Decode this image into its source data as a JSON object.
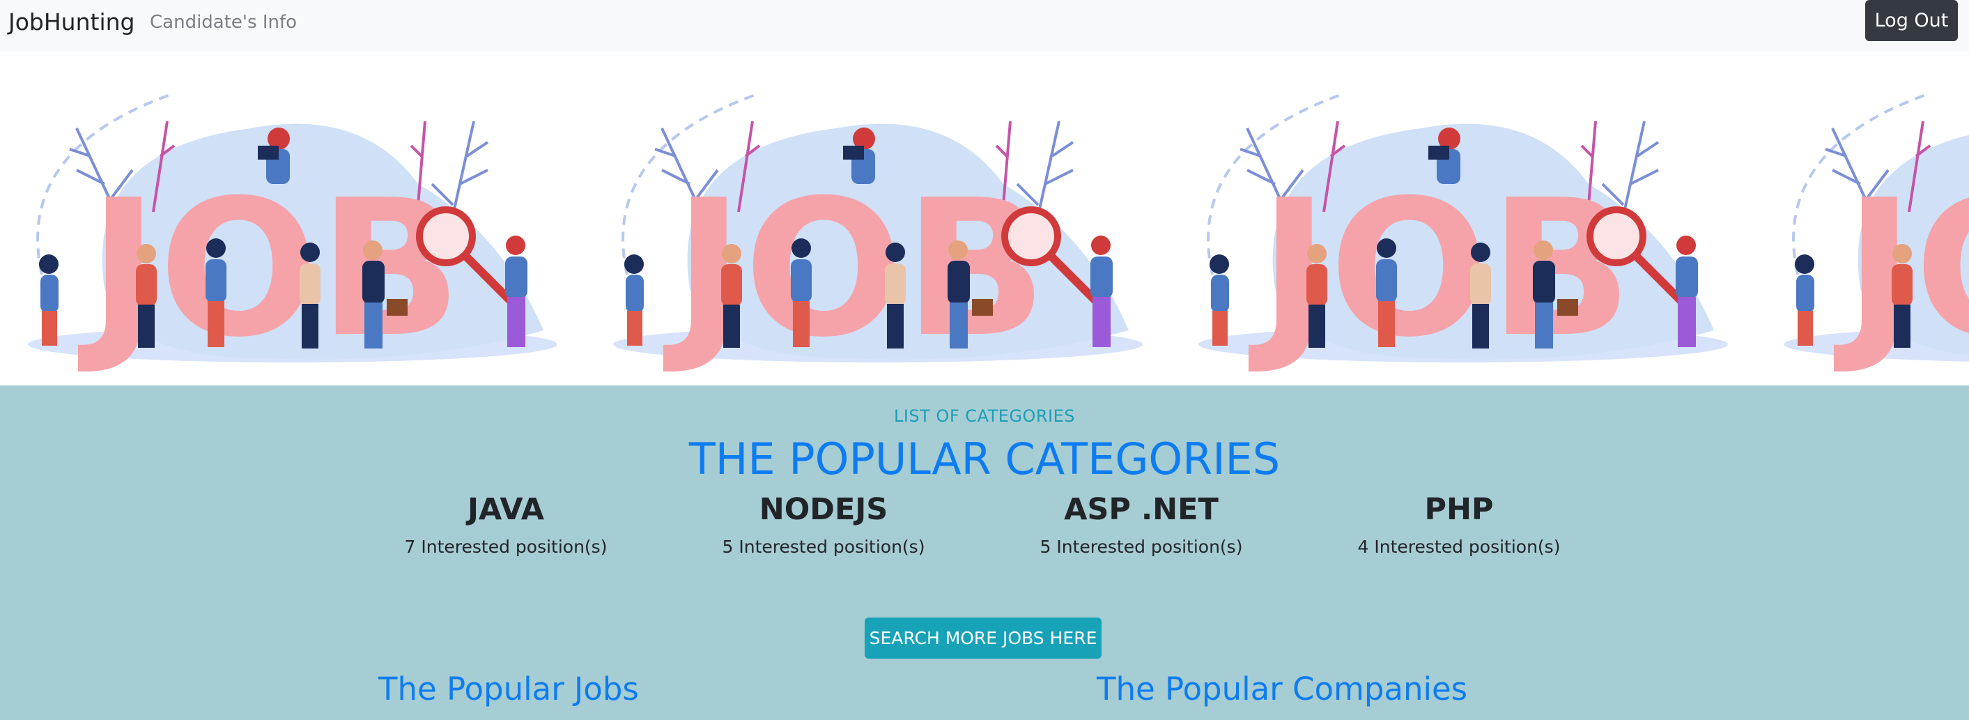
{
  "navbar": {
    "brand": "JobHunting",
    "nav_link": "Candidate's Info",
    "logout": "Log Out"
  },
  "banner": {
    "illustration_text": "JOB",
    "tile_count": 4
  },
  "categories": {
    "eyebrow": "LIST OF CATEGORIES",
    "title": "THE POPULAR CATEGORIES",
    "items": [
      {
        "name": "JAVA",
        "count": "7 Interested position(s)"
      },
      {
        "name": "NODEJS",
        "count": "5 Interested position(s)"
      },
      {
        "name": "ASP .NET",
        "count": "5 Interested position(s)"
      },
      {
        "name": "PHP",
        "count": "4 Interested position(s)"
      }
    ],
    "search_button": "SEARCH MORE JOBS HERE",
    "popular_jobs": "The Popular Jobs",
    "popular_companies": "The Popular Companies"
  },
  "colors": {
    "navbar_bg": "#f8f9fa",
    "logout_bg": "#343a40",
    "section_bg": "#a6cdd3",
    "heading_blue": "#0d7cf2",
    "eyebrow_teal": "#1b9fb7",
    "button_teal": "#17a2b8",
    "job_pink": "#f5a3a9",
    "blob_blue": "#cfe0f7",
    "leaf_blue": "#7b8fd6",
    "leaf_magenta": "#c554a6",
    "magnifier_red": "#d13a3a"
  }
}
